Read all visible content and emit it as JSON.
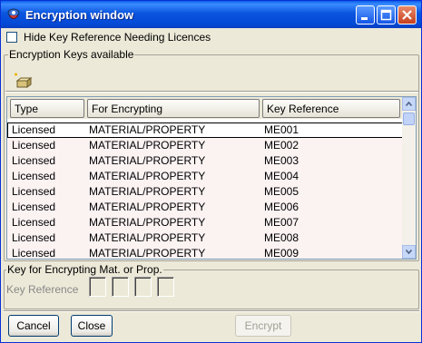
{
  "window": {
    "title": "Encryption window",
    "icon": "app-icon"
  },
  "filter": {
    "label": "Hide Key Reference Needing Licences",
    "checked": false
  },
  "keys_group": {
    "label": "Encryption Keys available",
    "toolbar_icon": "new-key-icon",
    "columns": [
      "Type",
      "For Encrypting",
      "Key Reference"
    ],
    "rows": [
      [
        "Licensed",
        "MATERIAL/PROPERTY",
        "ME001"
      ],
      [
        "Licensed",
        "MATERIAL/PROPERTY",
        "ME002"
      ],
      [
        "Licensed",
        "MATERIAL/PROPERTY",
        "ME003"
      ],
      [
        "Licensed",
        "MATERIAL/PROPERTY",
        "ME004"
      ],
      [
        "Licensed",
        "MATERIAL/PROPERTY",
        "ME005"
      ],
      [
        "Licensed",
        "MATERIAL/PROPERTY",
        "ME006"
      ],
      [
        "Licensed",
        "MATERIAL/PROPERTY",
        "ME007"
      ],
      [
        "Licensed",
        "MATERIAL/PROPERTY",
        "ME008"
      ],
      [
        "Licensed",
        "MATERIAL/PROPERTY",
        "ME009"
      ]
    ],
    "selected_row": 0
  },
  "encrypt_group": {
    "label": "Key for Encrypting Mat. or Prop.",
    "key_reference_label": "Key Reference"
  },
  "buttons": {
    "cancel": "Cancel",
    "close": "Close",
    "encrypt": "Encrypt"
  },
  "colors": {
    "title_bar": "#0a5fe8",
    "row_background": "#fbf2f2",
    "window_background": "#ece9d8"
  }
}
